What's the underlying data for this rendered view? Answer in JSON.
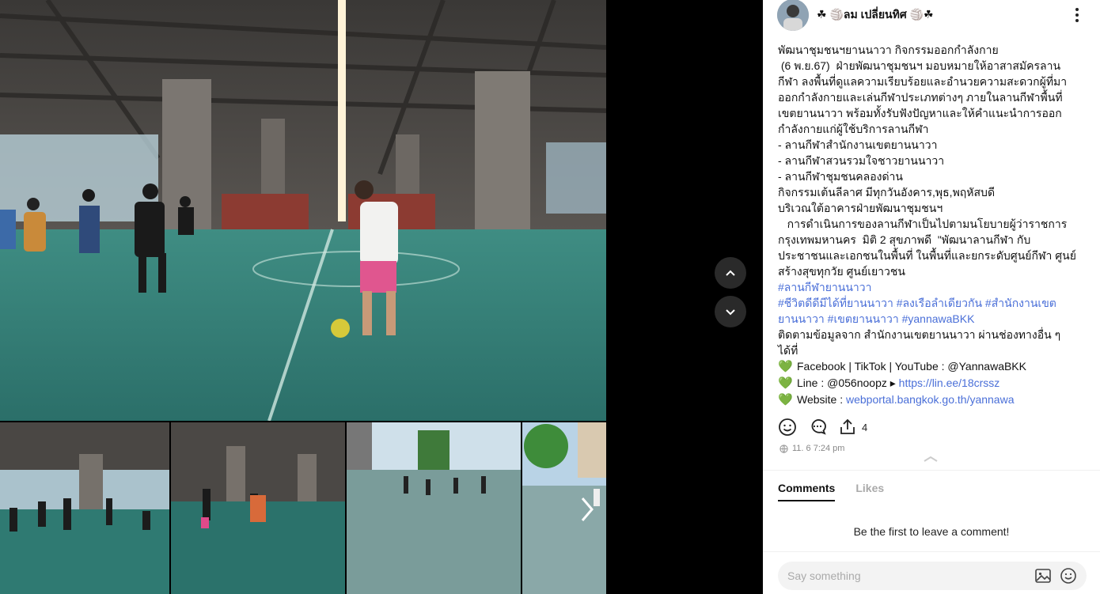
{
  "post": {
    "author_name": "☘ 🏐ลม เปลี่ยนทิศ 🏐☘",
    "text_lines": [
      "พัฒนาชุมชนฯยานนาวา กิจกรรมออกกำลังกาย",
      " (6 พ.ย.67)  ฝ่ายพัฒนาชุมชนฯ มอบหมายให้อาสาสมัครลาน",
      "กีฬา ลงพื้นที่ดูแลความเรียบร้อยและอำนวยความสะดวกผู้ที่มา",
      "ออกกำลังกายและเล่นกีฬาประเภทต่างๆ ภายในลานกีฬาพื้นที่",
      "เขตยานนาวา พร้อมทั้งรับฟังปัญหาและให้คำแนะนำการออก",
      "กำลังกายแก่ผู้ใช้บริการลานกีฬา",
      "- ลานกีฬาสำนักงานเขตยานนาวา",
      "- ลานกีฬาสวนรวมใจชาวยานนาวา",
      "- ลานกีฬาชุมชนคลองด่าน",
      "กิจกรรมเต้นลีลาศ มีทุกวันอังคาร,พุธ,พฤหัสบดี",
      "บริเวณใต้อาคารฝ่ายพัฒนาชุมชนฯ",
      "   การดำเนินการของลานกีฬาเป็นไปตามนโยบายผู้ว่าราชการ",
      "กรุงเทพมหานคร  มิติ 2 สุขภาพดี  \"พัฒนาลานกีฬา กับ",
      "ประชาชนและเอกชนในพื้นที่ ในพื้นที่และยกระดับศูนย์กีฬา ศูนย์",
      "สร้างสุขทุกวัย ศูนย์เยาวชน"
    ],
    "tag_line_1": "#ลานกีฬายานนาวา",
    "tag_line_2": "#ชีวิตดีดีมีได้ที่ยานนาวา #ลงเรือลำเดียวกัน #สำนักงานเขต",
    "tag_line_3": "ยานนาวา #เขตยานนาวา #yannawaBKK",
    "follow_line_1": "ติดตามข้อมูลจาก สำนักงานเขตยานนาวา ผ่านช่องทางอื่น ๆ",
    "follow_line_2": "ได้ที่",
    "contact_1": "Facebook | TikTok | YouTube : @YannawaBKK",
    "contact_2_prefix": "Line : @056noopz ▸ ",
    "contact_2_link": "https://lin.ee/18crssz",
    "contact_3_prefix": "Website : ",
    "contact_3_link": "webportal.bangkok.go.th/yannawa",
    "heart_glyph": "💚",
    "share_count": "4",
    "timestamp": "11. 6 7:24 pm"
  },
  "comments": {
    "tab_comments": "Comments",
    "tab_likes": "Likes",
    "empty_text": "Be the first to leave a comment!",
    "input_placeholder": "Say something"
  },
  "colors": {
    "hashtag": "#4a6fd8",
    "heart": "#1ec85a",
    "court": "#2e7c72"
  },
  "icons": [
    "chevron-up-icon",
    "chevron-down-icon",
    "chevron-right-icon",
    "more-vertical-icon",
    "smile-icon",
    "comment-icon",
    "share-icon",
    "globe-icon",
    "image-icon",
    "emoji-icon"
  ]
}
